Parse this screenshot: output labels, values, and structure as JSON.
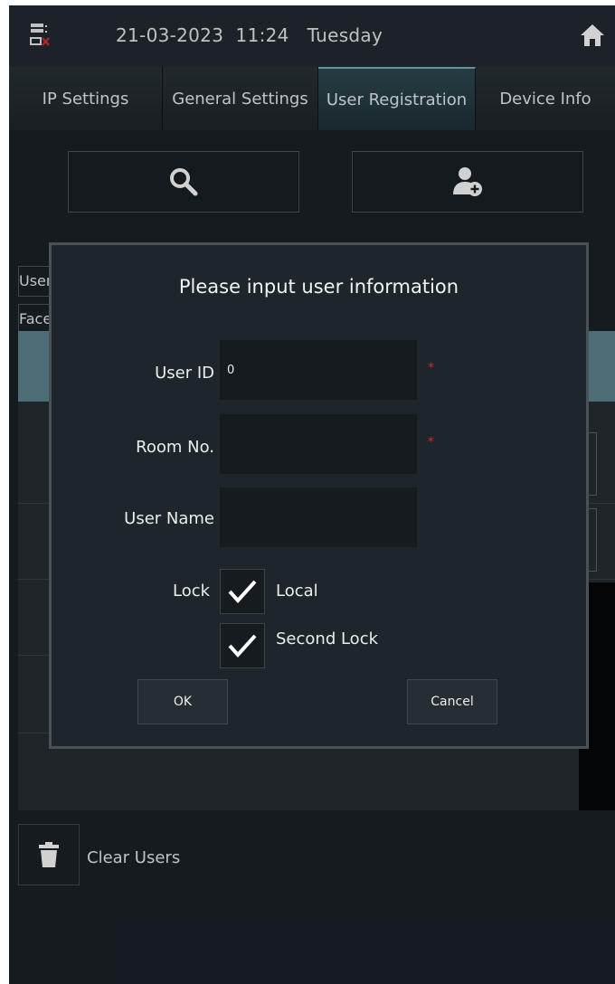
{
  "status_bar": {
    "datetime": "21-03-2023  11:24   Tuesday",
    "server_icon": "server-disconnected-icon",
    "home_icon": "home-icon"
  },
  "tabs": [
    {
      "label": "IP Settings",
      "active": false
    },
    {
      "label": "General Settings",
      "active": false
    },
    {
      "label": "User Registration",
      "active": true
    },
    {
      "label": "Device Info",
      "active": false
    }
  ],
  "toolbar": {
    "search_icon": "search-icon",
    "add_user_icon": "add-user-icon"
  },
  "background": {
    "user_label": "User",
    "face_label": "Face",
    "header_tail": "e",
    "clear_users_label": "Clear Users",
    "trash_icon": "trash-icon"
  },
  "dialog": {
    "title": "Please input user information",
    "user_id_label": "User ID",
    "user_id_value": "0",
    "room_no_label": "Room No.",
    "room_no_value": "",
    "user_name_label": "User Name",
    "user_name_value": "",
    "required_mark": "*",
    "lock_label": "Lock",
    "local_label": "Local",
    "local_checked": true,
    "second_lock_label": "Second Lock",
    "second_lock_checked": true,
    "ok_label": "OK",
    "cancel_label": "Cancel"
  },
  "colors": {
    "background": "#1a2127",
    "active_tab": "#2f4a52",
    "table_header": "#5f8592",
    "required": "#d42626"
  }
}
